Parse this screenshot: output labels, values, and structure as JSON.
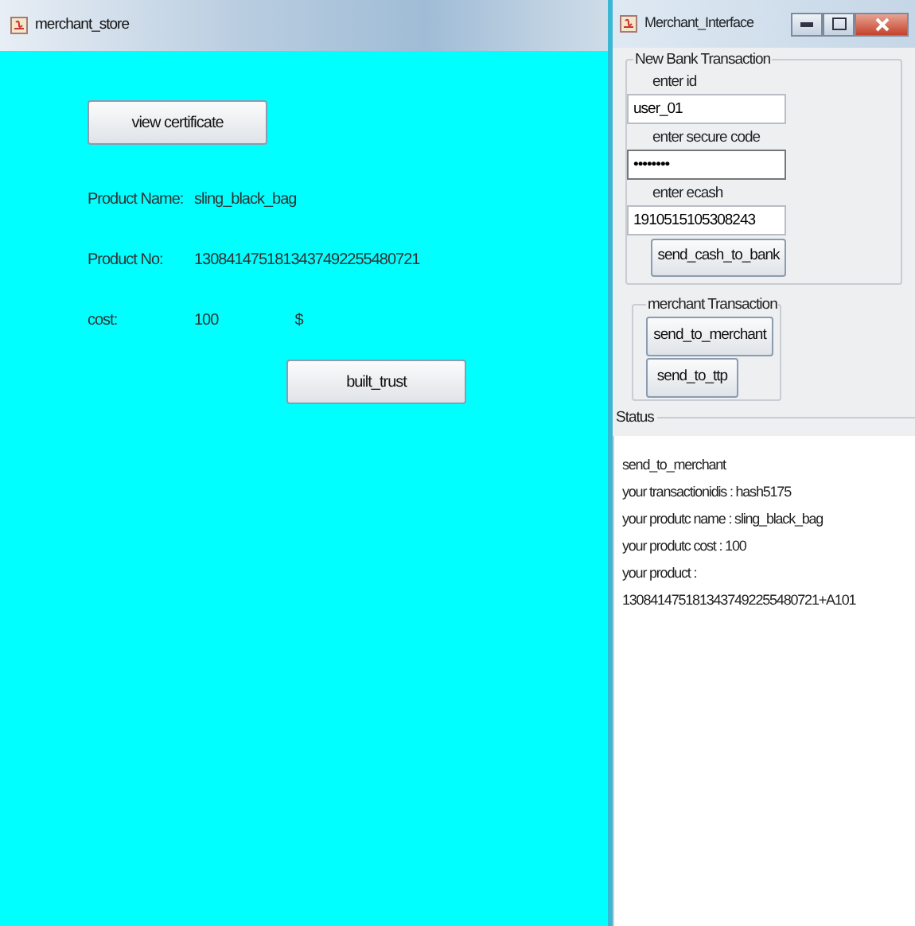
{
  "store_window": {
    "title": "merchant_store",
    "view_button": "view certificate",
    "fields": [
      {
        "label": "Product Name:",
        "value": "sling_black_bag"
      },
      {
        "label": "Product No:",
        "value": "1308414751813437492255480721"
      },
      {
        "label": "cost:",
        "value": "100",
        "unit": "$"
      }
    ],
    "trust_button": "built_trust"
  },
  "merchant_window": {
    "title": "Merchant_Interface",
    "bank_group": {
      "title": "New Bank Transaction",
      "fields": [
        {
          "label": "enter id",
          "value": "user_01"
        },
        {
          "label": "enter secure code",
          "value": "••••••••"
        },
        {
          "label": "enter ecash",
          "value": "1910515105308243"
        }
      ],
      "button": "send_cash_to_bank"
    },
    "merchant_group": {
      "title": "merchant Transaction",
      "buttons": [
        "send_to_merchant",
        "send_to_ttp"
      ]
    },
    "status": {
      "title": "Status",
      "lines": [
        "send_to_merchant",
        "your transactionidis : hash5175",
        "your produtc name : sling_black_bag",
        "your produtc cost : 100",
        "your product : 1308414751813437492255480721+A101"
      ]
    }
  }
}
